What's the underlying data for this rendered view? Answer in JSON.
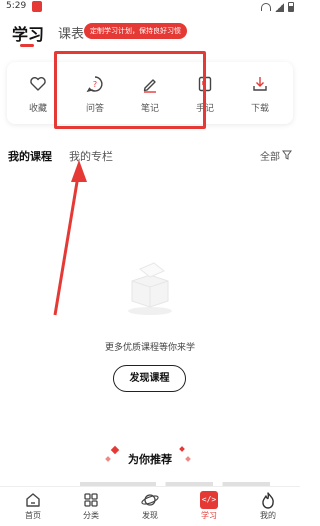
{
  "status_bar": {
    "time": "5:29"
  },
  "header": {
    "tabs": [
      {
        "label": "学习"
      },
      {
        "label": "课表"
      }
    ],
    "promo_badge": "定制学习计划，保持良好习惯"
  },
  "quick_actions": [
    {
      "label": "收藏",
      "icon": "heart-icon"
    },
    {
      "label": "问答",
      "icon": "question-icon"
    },
    {
      "label": "笔记",
      "icon": "pencil-icon"
    },
    {
      "label": "手记",
      "icon": "notebook-icon"
    },
    {
      "label": "下载",
      "icon": "download-icon"
    }
  ],
  "course_tabs": {
    "my_courses": "我的课程",
    "my_columns": "我的专栏",
    "filter_label": "全部"
  },
  "empty_state": {
    "message": "更多优质课程等你来学",
    "button_label": "发现课程"
  },
  "recommend": {
    "title": "为你推荐"
  },
  "bottom_nav": [
    {
      "label": "首页",
      "icon": "home-icon"
    },
    {
      "label": "分类",
      "icon": "grid-icon"
    },
    {
      "label": "发现",
      "icon": "planet-icon"
    },
    {
      "label": "学习",
      "icon": "code-icon",
      "active": true
    },
    {
      "label": "我的",
      "icon": "flame-icon"
    }
  ],
  "colors": {
    "accent": "#e53935",
    "annotation": "#e53935"
  }
}
